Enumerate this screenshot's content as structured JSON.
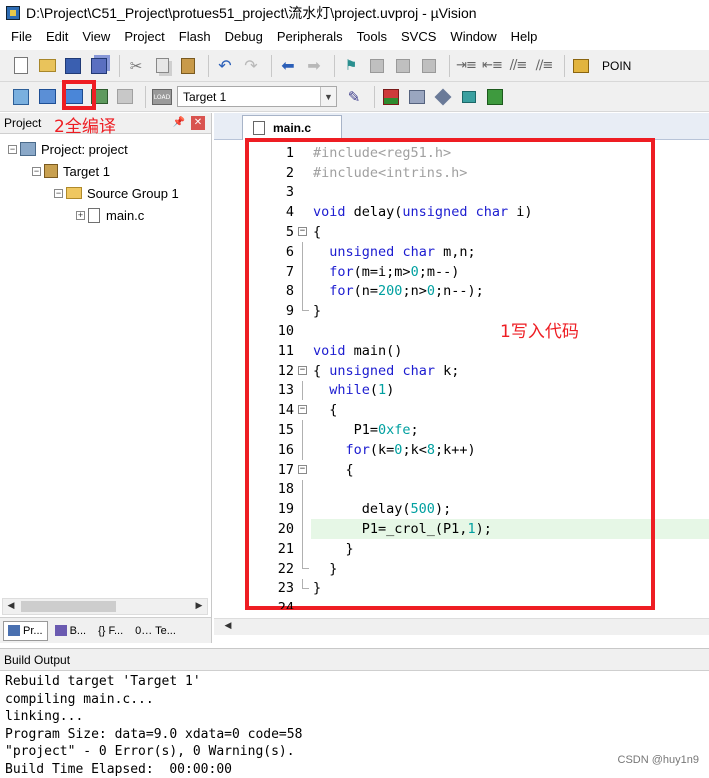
{
  "window": {
    "title": "D:\\Project\\C51_Project\\protues51_project\\流水灯\\project.uvproj - µVision"
  },
  "menu": [
    "File",
    "Edit",
    "View",
    "Project",
    "Flash",
    "Debug",
    "Peripherals",
    "Tools",
    "SVCS",
    "Window",
    "Help"
  ],
  "toolbar": {
    "poin_label": "POIN",
    "target_select": "Target 1",
    "load_label": "LOAD"
  },
  "project_panel": {
    "title": "Project",
    "tree": {
      "project": "Project: project",
      "target": "Target 1",
      "group": "Source Group 1",
      "file": "main.c"
    },
    "tabs": [
      "Pr...",
      "B...",
      "{} F...",
      "0… Te..."
    ]
  },
  "editor": {
    "tab_label": "main.c",
    "highlighted_line": 20,
    "lines": [
      "#include<reg51.h>",
      "#include<intrins.h>",
      "",
      "void delay(unsigned char i)",
      "{",
      "  unsigned char m,n;",
      "  for(m=i;m>0;m--)",
      "  for(n=200;n>0;n--);",
      "}",
      "",
      "void main()",
      "{ unsigned char k;",
      "  while(1)",
      "  {",
      "     P1=0xfe;",
      "    for(k=0;k<8;k++)",
      "    {",
      "",
      "      delay(500);",
      "      P1=_crol_(P1,1);",
      "    }",
      "  }",
      "}",
      ""
    ]
  },
  "build_output": {
    "title": "Build Output",
    "lines": [
      "Rebuild target 'Target 1'",
      "compiling main.c...",
      "linking...",
      "Program Size: data=9.0 xdata=0 code=58",
      "\"project\" - 0 Error(s), 0 Warning(s).",
      "Build Time Elapsed:  00:00:00"
    ]
  },
  "annotations": {
    "rebuild_label": "2全编译",
    "code_label": "1写入代码"
  },
  "watermark": "CSDN @huy1n9",
  "colors": {
    "annotation_red": "#ee1d23",
    "keyword_blue": "#1c1cd0",
    "number_teal": "#00a0a0",
    "current_line": "#e6f7e6"
  }
}
